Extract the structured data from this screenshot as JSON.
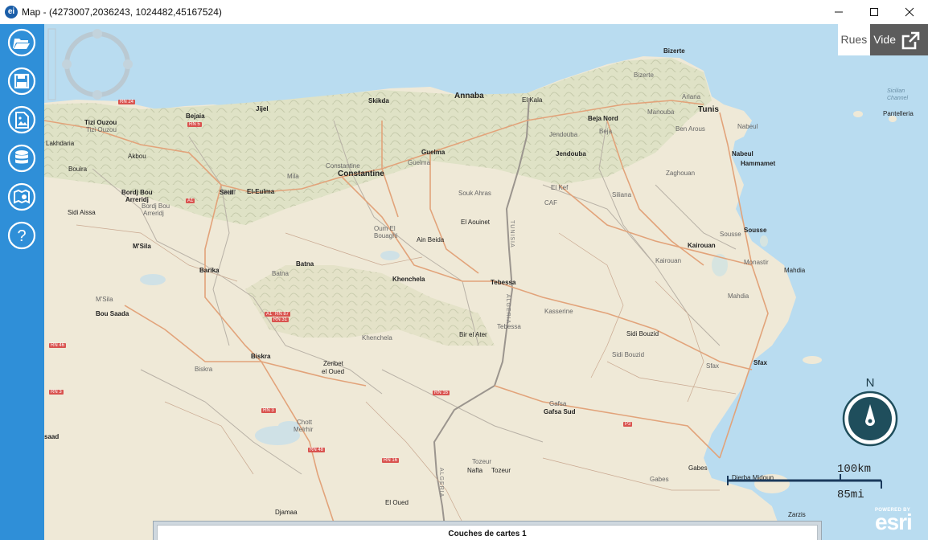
{
  "window": {
    "app_icon_label": "ei",
    "title": "Map - (4273007,2036243, 1024482,45167524)"
  },
  "sidebar": {
    "items": [
      {
        "name": "open-folder-icon"
      },
      {
        "name": "save-icon"
      },
      {
        "name": "export-image-icon"
      },
      {
        "name": "database-icon"
      },
      {
        "name": "map-book-icon"
      },
      {
        "name": "help-icon"
      }
    ]
  },
  "basemap": {
    "options": [
      "Rues",
      "Vide"
    ],
    "selected": "Vide"
  },
  "map": {
    "labels": [
      {
        "t": "Tizi Ouzou",
        "c": "city"
      },
      {
        "t": "Tizi Ouzou",
        "c": "grey"
      },
      {
        "t": "Lakhdaria",
        "c": ""
      },
      {
        "t": "Bejaia",
        "c": "city"
      },
      {
        "t": "Jijel",
        "c": "city"
      },
      {
        "t": "Skikda",
        "c": "city"
      },
      {
        "t": "Annaba",
        "c": "big"
      },
      {
        "t": "El Kala",
        "c": ""
      },
      {
        "t": "Bizerte",
        "c": "city"
      },
      {
        "t": "Bizerte",
        "c": "grey"
      },
      {
        "t": "Tunis",
        "c": "big"
      },
      {
        "t": "Manouba",
        "c": "grey"
      },
      {
        "t": "Ariana",
        "c": "grey"
      },
      {
        "t": "Ben Arous",
        "c": "grey"
      },
      {
        "t": "Nabeul",
        "c": "grey"
      },
      {
        "t": "Nabeul",
        "c": "city"
      },
      {
        "t": "Hammamet",
        "c": "city"
      },
      {
        "t": "Beja Nord",
        "c": "city"
      },
      {
        "t": "Beja",
        "c": "grey"
      },
      {
        "t": "Jendouba",
        "c": "grey"
      },
      {
        "t": "Jendouba",
        "c": "city"
      },
      {
        "t": "Guelma",
        "c": "city"
      },
      {
        "t": "Guelma",
        "c": "grey"
      },
      {
        "t": "Constantine",
        "c": "big"
      },
      {
        "t": "Constantine",
        "c": "grey"
      },
      {
        "t": "Mila",
        "c": "grey"
      },
      {
        "t": "Setif",
        "c": "city"
      },
      {
        "t": "Setif",
        "c": "grey"
      },
      {
        "t": "El-Eulma",
        "c": "city"
      },
      {
        "t": "Bordj Bou",
        "c": "city"
      },
      {
        "t": "Arreridj",
        "c": "city"
      },
      {
        "t": "Bordj Bou",
        "c": "grey"
      },
      {
        "t": "Arreridj",
        "c": "grey"
      },
      {
        "t": "Akbou",
        "c": ""
      },
      {
        "t": "Bouira",
        "c": ""
      },
      {
        "t": "Sidi Aissa",
        "c": ""
      },
      {
        "t": "M'Sila",
        "c": "city"
      },
      {
        "t": "Barika",
        "c": "city"
      },
      {
        "t": "Batna",
        "c": "city"
      },
      {
        "t": "Batna",
        "c": "grey"
      },
      {
        "t": "Khenchela",
        "c": "city"
      },
      {
        "t": "Oum El",
        "c": "grey"
      },
      {
        "t": "Bouaghi",
        "c": "grey"
      },
      {
        "t": "Ain Beida",
        "c": ""
      },
      {
        "t": "Souk Ahras",
        "c": "grey"
      },
      {
        "t": "El Kef",
        "c": "grey"
      },
      {
        "t": "Siliana",
        "c": "grey"
      },
      {
        "t": "Zaghouan",
        "c": "grey"
      },
      {
        "t": "CAF",
        "c": "grey"
      },
      {
        "t": "El Aouinet",
        "c": ""
      },
      {
        "t": "Tebessa",
        "c": "city"
      },
      {
        "t": "Tebessa",
        "c": "grey"
      },
      {
        "t": "Bir el Ater",
        "c": ""
      },
      {
        "t": "Khenchela",
        "c": "grey"
      },
      {
        "t": "Kairouan",
        "c": "city"
      },
      {
        "t": "Kairouan",
        "c": "grey"
      },
      {
        "t": "Sousse",
        "c": "city"
      },
      {
        "t": "Sousse",
        "c": "grey"
      },
      {
        "t": "Monastir",
        "c": "grey"
      },
      {
        "t": "Mahdia",
        "c": ""
      },
      {
        "t": "Mahdia",
        "c": "grey"
      },
      {
        "t": "Kasserine",
        "c": "grey"
      },
      {
        "t": "Sidi Bouzid",
        "c": ""
      },
      {
        "t": "Sidi Bouzid",
        "c": "grey"
      },
      {
        "t": "Sfax",
        "c": "city"
      },
      {
        "t": "Sfax",
        "c": "grey"
      },
      {
        "t": "M'Sila",
        "c": "grey"
      },
      {
        "t": "Bou Saada",
        "c": "city"
      },
      {
        "t": "Biskra",
        "c": "city"
      },
      {
        "t": "Biskra",
        "c": "grey"
      },
      {
        "t": "Zeribet",
        "c": ""
      },
      {
        "t": "el Oued",
        "c": ""
      },
      {
        "t": "Gafsa",
        "c": "grey"
      },
      {
        "t": "Gafsa Sud",
        "c": "city"
      },
      {
        "t": "Chott",
        "c": "grey"
      },
      {
        "t": "Melrhir",
        "c": "grey"
      },
      {
        "t": "Tozeur",
        "c": "grey"
      },
      {
        "t": "Nafta",
        "c": ""
      },
      {
        "t": "Tozeur",
        "c": ""
      },
      {
        "t": "Gabes",
        "c": ""
      },
      {
        "t": "Gabes",
        "c": "grey"
      },
      {
        "t": "Djerba Midoun",
        "c": ""
      },
      {
        "t": "Zarzis",
        "c": ""
      },
      {
        "t": "El Oued",
        "c": ""
      },
      {
        "t": "Djamaa",
        "c": ""
      },
      {
        "t": "saad",
        "c": "city"
      },
      {
        "t": "Pantelleria",
        "c": ""
      }
    ],
    "sea_labels": [
      "Sicilian",
      "Channel"
    ],
    "border_labels": [
      "TUNISIA",
      "ALGERIA",
      "ALGERIA"
    ],
    "road_shields": [
      "RN 24",
      "RN 5",
      "RN 87",
      "RN 31",
      "RN 46",
      "RN 16",
      "RN 3",
      "RN 48",
      "RN 3",
      "A1",
      "A1",
      "RN 16",
      "P3"
    ],
    "compass_label": "N",
    "scale": {
      "km": "100km",
      "mi": "85mi"
    },
    "attribution": {
      "powered": "POWERED BY",
      "brand": "esri"
    }
  },
  "layers_panel": {
    "title": "Couches de cartes  1"
  }
}
